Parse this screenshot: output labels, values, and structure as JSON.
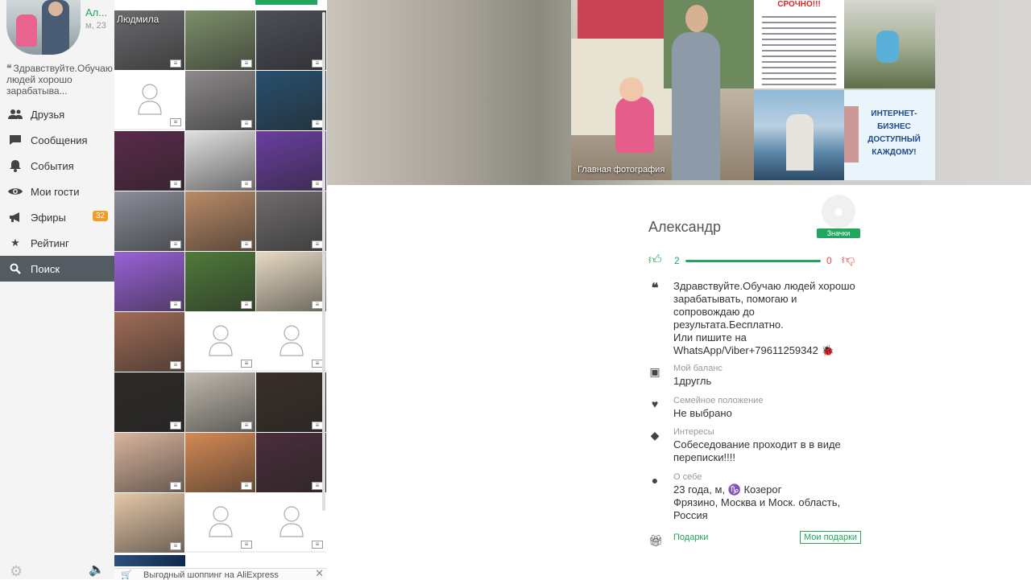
{
  "sidebar": {
    "profile_name": "Ал...",
    "profile_meta": "м, 23",
    "status": "Здравствуйте.Обучаю людей хорошо зарабатыва...",
    "items": [
      {
        "label": "Друзья",
        "icon": "friends-icon"
      },
      {
        "label": "Сообщения",
        "icon": "messages-icon"
      },
      {
        "label": "События",
        "icon": "bell-icon"
      },
      {
        "label": "Мои гости",
        "icon": "eye-icon"
      },
      {
        "label": "Эфиры",
        "icon": "megaphone-icon",
        "badge": "32"
      },
      {
        "label": "Рейтинг",
        "icon": "star-icon"
      },
      {
        "label": "Поиск",
        "icon": "search-icon",
        "active": true
      }
    ]
  },
  "grid": {
    "first_name": "Людмила",
    "cells": [
      "photo",
      "photo",
      "photo",
      "empty",
      "photo",
      "photo",
      "photo",
      "photo",
      "photo",
      "photo",
      "photo",
      "photo",
      "photo",
      "photo",
      "photo",
      "photo",
      "empty",
      "empty",
      "photo",
      "photo",
      "photo",
      "photo",
      "photo",
      "photo",
      "photo",
      "empty",
      "empty"
    ],
    "cell_colors": [
      "#6b6a6d",
      "#7d8f6a",
      "#4d4f59",
      "#ffffff",
      "#8d8a8c",
      "#28506e",
      "#5b2a4a",
      "#e0e0e0",
      "#6a3ea0",
      "#8a8e99",
      "#b98a66",
      "#6f6d6c",
      "#9a62d8",
      "#4f7a3a",
      "#e8dbc4",
      "#a06c56",
      "#ffffff",
      "#ffffff",
      "#2d2b29",
      "#bfb9ad",
      "#3a2f2a",
      "#d9b59d",
      "#d58a55",
      "#4a2e3a",
      "#e6c8a8",
      "#ffffff",
      "#ffffff"
    ]
  },
  "ad": {
    "text": "Выгодный шоппинг на AliExpress"
  },
  "banner": {
    "main_label": "Главная фотография",
    "urgent": "СРОЧНО!!!",
    "business": "ИНТЕРНЕТ-БИЗНЕС ДОСТУПНЫЙ КАЖДОМУ!"
  },
  "profile": {
    "name": "Александр",
    "badges_label": "Значки",
    "likes": "2",
    "dislikes": "0",
    "quote": "Здравствуйте.Обучаю людей хорошо\nзарабатывать, помогаю и\nсопровождаю до\nрезультата.Бесплатно.\nИли пишите на\nWhatsApp/Viber+79611259342 🐞",
    "balance_label": "Мой баланс",
    "balance_value": "1другль",
    "family_label": "Семейное положение",
    "family_value": "Не выбрано",
    "interests_label": "Интересы",
    "interests_value": "Собеседование проходит в в виде\nпереписки!!!!",
    "about_label": "О себе",
    "about_value": "23 года, м, ♑ Козерог\nФрязино, Москва и Моск. область,\nРоссия",
    "gifts_label": "Подарки",
    "my_gifts_label": "Мои подарки"
  },
  "colors": {
    "accent": "#21a65b",
    "badge": "#f59a23",
    "dislike": "#e44444",
    "active_nav": "#555b63"
  }
}
